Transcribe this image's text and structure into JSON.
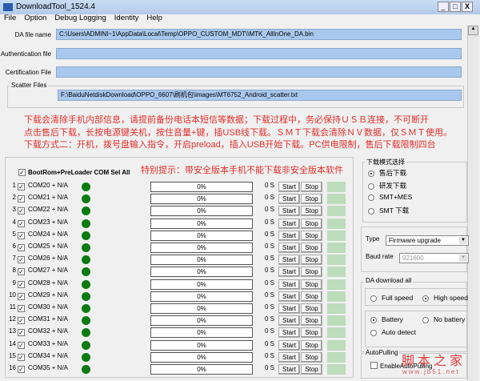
{
  "window": {
    "title": "DownloadTool_1524.4",
    "min": "_",
    "max": "□",
    "close": "X"
  },
  "menu": [
    "File",
    "Option",
    "Debug Logging",
    "Identity",
    "Help"
  ],
  "fields": {
    "da_label": "DA file name",
    "da_value": "C:\\Users\\ADMINI~1\\AppData\\Local\\Temp\\OPPO_CUSTOM_MDT\\\\MTK_AllInOne_DA.bin",
    "auth_label": "Authentication file",
    "auth_value": "",
    "cert_label": "Certification File",
    "cert_value": "",
    "scatter_group": "Scatter Files",
    "scatter_value": "F:\\BaiduNetdiskDownload\\OPPO_6607\\刷机包\\images\\MT6752_Android_scatter.txt"
  },
  "notice": [
    "下载会清除手机内部信息，请提前备份电话本短信等数据；下载过程中，务必保持ＵＳＢ连接，不可断开",
    "点击售后下载，长按电源键关机，按住音量+键，插USB线下载。ＳＭＴ下载会清除ＮＶ数据，仅ＳＭＴ使用。",
    "下载方式二：开机，拨号盘输入指令，开启preload，插入USB开始下载。PC供电限制，售后下载限制四台"
  ],
  "warning": "特别提示：带安全版本手机不能下载非安全版本软件",
  "select_all": "BootRom+PreLoader COM Sel All",
  "ports": [
    {
      "n": "1",
      "com": "COM20 + N/A",
      "progress": "0%",
      "time": "0 S"
    },
    {
      "n": "2",
      "com": "COM21 + N/A",
      "progress": "0%",
      "time": "0 S"
    },
    {
      "n": "3",
      "com": "COM22 + N/A",
      "progress": "0%",
      "time": "0 S"
    },
    {
      "n": "4",
      "com": "COM23 + N/A",
      "progress": "0%",
      "time": "0 S"
    },
    {
      "n": "5",
      "com": "COM24 + N/A",
      "progress": "0%",
      "time": "0 S"
    },
    {
      "n": "6",
      "com": "COM25 + N/A",
      "progress": "0%",
      "time": "0 S"
    },
    {
      "n": "7",
      "com": "COM26 + N/A",
      "progress": "0%",
      "time": "0 S"
    },
    {
      "n": "8",
      "com": "COM27 + N/A",
      "progress": "0%",
      "time": "0 S"
    },
    {
      "n": "9",
      "com": "COM28 + N/A",
      "progress": "0%",
      "time": "0 S"
    },
    {
      "n": "10",
      "com": "COM29 + N/A",
      "progress": "0%",
      "time": "0 S"
    },
    {
      "n": "11",
      "com": "COM30 + N/A",
      "progress": "0%",
      "time": "0 S"
    },
    {
      "n": "12",
      "com": "COM31 + N/A",
      "progress": "0%",
      "time": "0 S"
    },
    {
      "n": "13",
      "com": "COM32 + N/A",
      "progress": "0%",
      "time": "0 S"
    },
    {
      "n": "14",
      "com": "COM33 + N/A",
      "progress": "0%",
      "time": "0 S"
    },
    {
      "n": "15",
      "com": "COM34 + N/A",
      "progress": "0%",
      "time": "0 S"
    },
    {
      "n": "16",
      "com": "COM35 + N/A",
      "progress": "0%",
      "time": "0 S"
    }
  ],
  "buttons": {
    "start": "Start",
    "stop": "Stop"
  },
  "mode": {
    "title": "下载模式选择",
    "options": [
      "售后下载",
      "研发下载",
      "SMT+MES",
      "SMT 下载"
    ],
    "selected": 0
  },
  "type": {
    "label": "Type",
    "value": "Firmware upgrade",
    "baud_label": "Baud rate",
    "baud_value": "921600"
  },
  "da_all": {
    "title": "DA download all",
    "full": "Full speed",
    "high": "High speed",
    "battery": "Battery",
    "nobattery": "No battery",
    "auto": "Auto detect"
  },
  "autopulling": {
    "title": "AutoPulling",
    "enable": "EnableAutoPulling"
  },
  "watermark": {
    "cn": "脚本之家",
    "url": "www.jb51.net"
  }
}
